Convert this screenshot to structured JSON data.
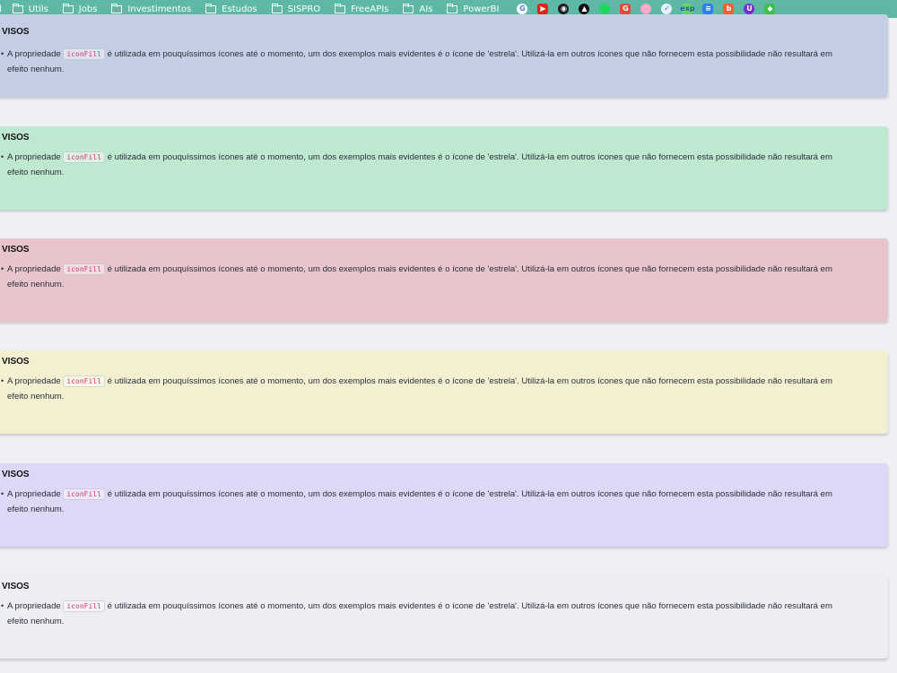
{
  "bookmarks": {
    "first_label": "l",
    "folders": [
      "Utils",
      "Jobs",
      "Investimentos",
      "Estudos",
      "SISPRO",
      "FreeAPIs",
      "AIs",
      "PowerBI"
    ],
    "apps": [
      {
        "name": "google-icon",
        "glyph": "G",
        "color": "#ffffff",
        "text_color": "#4285f4",
        "round": true
      },
      {
        "name": "youtube-icon",
        "glyph": "▶",
        "color": "#e62117",
        "text_color": "#ffffff",
        "round": false
      },
      {
        "name": "github-icon",
        "glyph": "◉",
        "color": "#1b1f23",
        "text_color": "#ffffff",
        "round": true
      },
      {
        "name": "vercel-icon",
        "glyph": "▲",
        "color": "#111111",
        "text_color": "#ffffff",
        "round": true
      },
      {
        "name": "spotify-icon",
        "glyph": "●",
        "color": "#1ed760",
        "text_color": "#1ed760",
        "round": true
      },
      {
        "name": "google-red-icon",
        "glyph": "G",
        "color": "#e8453c",
        "text_color": "#ffffff",
        "round": false
      },
      {
        "name": "pink-circle-icon",
        "glyph": "◌",
        "color": "#f4a6c6",
        "text_color": "#ffffff",
        "round": true
      },
      {
        "name": "check-icon",
        "glyph": "✓",
        "color": "#e8f0ff",
        "text_color": "#3b6fd8",
        "round": true
      },
      {
        "name": "exp-icon",
        "glyph": "exp",
        "color": "#6bd35a",
        "text_color": "#1a5fb4",
        "round": false
      },
      {
        "name": "blue-square-icon",
        "glyph": "≡",
        "color": "#2d7ff9",
        "text_color": "#ffffff",
        "round": false
      },
      {
        "name": "orange-square-icon",
        "glyph": "b",
        "color": "#ff5a36",
        "text_color": "#ffffff",
        "round": false
      },
      {
        "name": "purple-circle-icon",
        "glyph": "U",
        "color": "#7a2bd6",
        "text_color": "#ffffff",
        "round": true
      },
      {
        "name": "green-square-icon",
        "glyph": "◆",
        "color": "#3dbf4a",
        "text_color": "#ffffff",
        "round": false
      }
    ]
  },
  "callouts": [
    {
      "title": "VISOS",
      "text_before": "A propriedade ",
      "code": "iconFill",
      "text_after": " é utilizada em pouquíssimos ícones até o momento, um dos exemplos mais evidentes é o ícone de 'estrela'. Utilizá-la em outros ícones que não fornecem esta possibilidade não resultará em efeito nenhum."
    },
    {
      "title": "VISOS",
      "text_before": "A propriedade ",
      "code": "iconFill",
      "text_after": " é utilizada em pouquíssimos ícones até o momento, um dos exemplos mais evidentes é o ícone de 'estrela'. Utilizá-la em outros ícones que não fornecem esta possibilidade não resultará em efeito nenhum."
    },
    {
      "title": "VISOS",
      "text_before": "A propriedade ",
      "code": "iconFill",
      "text_after": " é utilizada em pouquíssimos ícones até o momento, um dos exemplos mais evidentes é o ícone de 'estrela'. Utilizá-la em outros ícones que não fornecem esta possibilidade não resultará em efeito nenhum."
    },
    {
      "title": "VISOS",
      "text_before": "A propriedade ",
      "code": "iconFill",
      "text_after": " é utilizada em pouquíssimos ícones até o momento, um dos exemplos mais evidentes é o ícone de 'estrela'. Utilizá-la em outros ícones que não fornecem esta possibilidade não resultará em efeito nenhum."
    },
    {
      "title": "VISOS",
      "text_before": "A propriedade ",
      "code": "iconFill",
      "text_after": " é utilizada em pouquíssimos ícones até o momento, um dos exemplos mais evidentes é o ícone de 'estrela'. Utilizá-la em outros ícones que não fornecem esta possibilidade não resultará em efeito nenhum."
    },
    {
      "title": "VISOS",
      "text_before": "A propriedade ",
      "code": "iconFill",
      "text_after": " é utilizada em pouquíssimos ícones até o momento, um dos exemplos mais evidentes é o ícone de 'estrela'. Utilizá-la em outros ícones que não fornecem esta possibilidade não resultará em efeito nenhum."
    }
  ]
}
